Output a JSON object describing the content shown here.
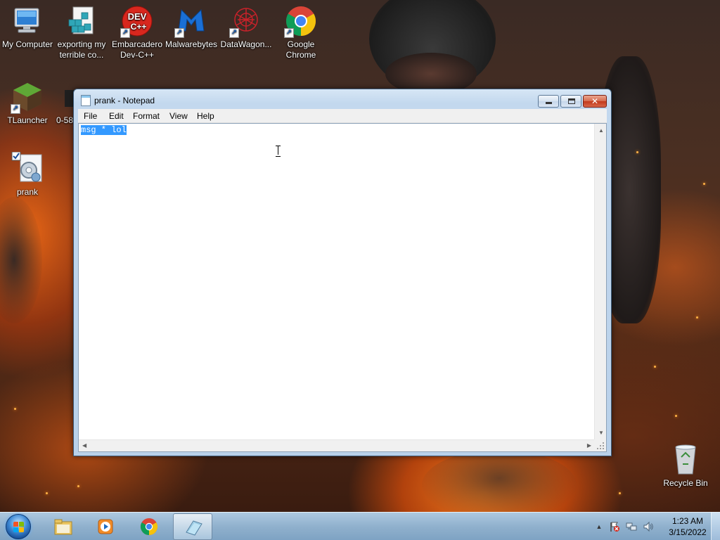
{
  "desktop": {
    "icons": [
      {
        "label": "My Computer"
      },
      {
        "label": "exporting my terrible co..."
      },
      {
        "label": "Embarcadero Dev-C++"
      },
      {
        "label": "Malwarebytes"
      },
      {
        "label": "DataWagon..."
      },
      {
        "label": "Google Chrome"
      },
      {
        "label": "TLauncher"
      },
      {
        "label": "0-58"
      },
      {
        "label": "prank"
      },
      {
        "label": "Recycle Bin"
      }
    ],
    "devcpp_badge": "DEV\nC++"
  },
  "notepad": {
    "title": "prank - Notepad",
    "menu": [
      "File",
      "Edit",
      "Format",
      "View",
      "Help"
    ],
    "content": "msg * lol",
    "selected_text": "msg * lol"
  },
  "taskbar": {
    "pinned": [
      "Windows Explorer",
      "Windows Media Player",
      "Google Chrome",
      "Notepad"
    ],
    "active": "Notepad",
    "clock_time": "1:23 AM",
    "clock_date": "3/15/2022"
  },
  "colors": {
    "selection": "#3399ff",
    "taskbar": "#96b9d7"
  }
}
